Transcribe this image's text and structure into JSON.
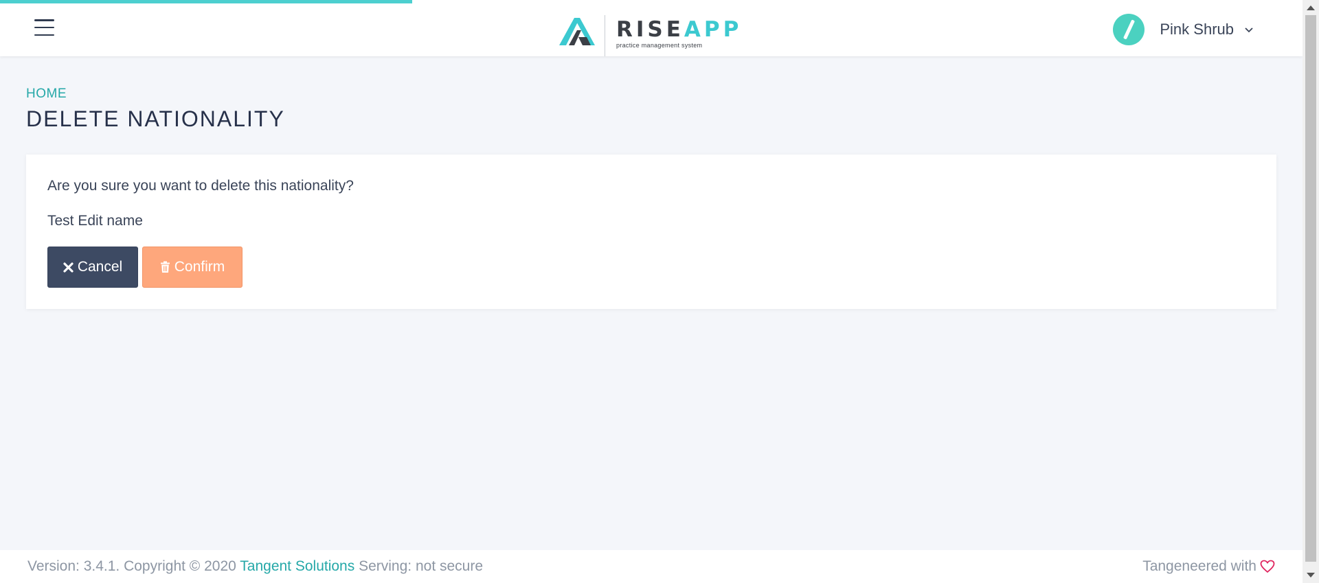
{
  "header": {
    "menu_icon": "hamburger-icon",
    "logo": {
      "word_rise": "RISE",
      "word_app": "APP",
      "tagline": "practice management system"
    },
    "user": {
      "name": "Pink Shrub",
      "avatar_icon": "slash-avatar-icon",
      "dropdown_icon": "chevron-down-icon"
    }
  },
  "page": {
    "breadcrumb": "HOME",
    "title": "DELETE NATIONALITY"
  },
  "dialog": {
    "question": "Are you sure you want to delete this nationality?",
    "item_name": "Test Edit name",
    "cancel_label": "Cancel",
    "confirm_label": "Confirm"
  },
  "footer": {
    "version_text": "Version: 3.4.1. Copyright © 2020 ",
    "company_link": "Tangent Solutions",
    "serving_text": " Serving: not secure",
    "right_text": "Tangeneered with"
  },
  "colors": {
    "accent": "#25a8a8",
    "progress": "#4ccfcf",
    "cancel_bg": "#3d4a63",
    "confirm_bg": "#fea77c",
    "heart": "#e0245e"
  }
}
